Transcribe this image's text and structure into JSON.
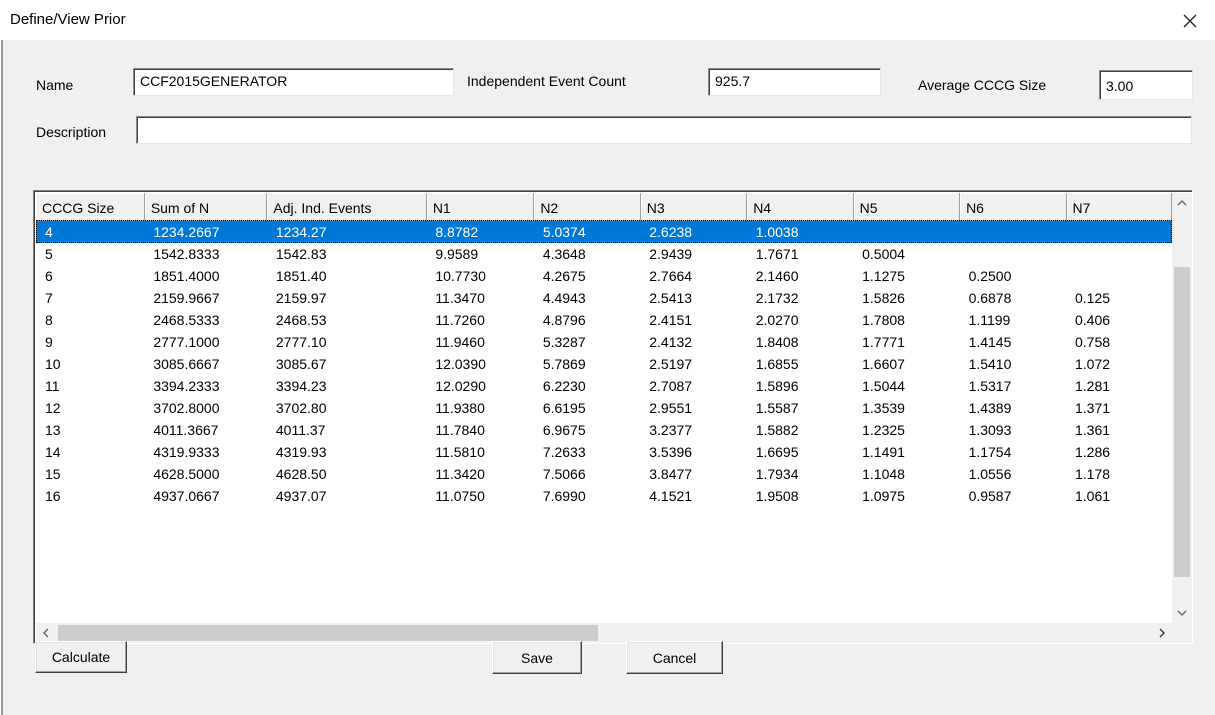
{
  "window": {
    "title": "Define/View Prior"
  },
  "form": {
    "name_label": "Name",
    "name_value": "CCF2015GENERATOR",
    "iec_label": "Independent Event Count",
    "iec_value": "925.7",
    "acs_label": "Average CCCG Size",
    "acs_value": "3.00",
    "desc_label": "Description",
    "desc_value": ""
  },
  "grid": {
    "columns": [
      "CCCG Size",
      "Sum of N",
      "Adj. Ind. Events",
      "N1",
      "N2",
      "N3",
      "N4",
      "N5",
      "N6",
      "N7"
    ],
    "selected_row": 0,
    "rows": [
      [
        "4",
        "1234.2667",
        "1234.27",
        "8.8782",
        "5.0374",
        "2.6238",
        "1.0038",
        "",
        "",
        ""
      ],
      [
        "5",
        "1542.8333",
        "1542.83",
        "9.9589",
        "4.3648",
        "2.9439",
        "1.7671",
        "0.5004",
        "",
        ""
      ],
      [
        "6",
        "1851.4000",
        "1851.40",
        "10.7730",
        "4.2675",
        "2.7664",
        "2.1460",
        "1.1275",
        "0.2500",
        ""
      ],
      [
        "7",
        "2159.9667",
        "2159.97",
        "11.3470",
        "4.4943",
        "2.5413",
        "2.1732",
        "1.5826",
        "0.6878",
        "0.125"
      ],
      [
        "8",
        "2468.5333",
        "2468.53",
        "11.7260",
        "4.8796",
        "2.4151",
        "2.0270",
        "1.7808",
        "1.1199",
        "0.406"
      ],
      [
        "9",
        "2777.1000",
        "2777.10",
        "11.9460",
        "5.3287",
        "2.4132",
        "1.8408",
        "1.7771",
        "1.4145",
        "0.758"
      ],
      [
        "10",
        "3085.6667",
        "3085.67",
        "12.0390",
        "5.7869",
        "2.5197",
        "1.6855",
        "1.6607",
        "1.5410",
        "1.072"
      ],
      [
        "11",
        "3394.2333",
        "3394.23",
        "12.0290",
        "6.2230",
        "2.7087",
        "1.5896",
        "1.5044",
        "1.5317",
        "1.281"
      ],
      [
        "12",
        "3702.8000",
        "3702.80",
        "11.9380",
        "6.6195",
        "2.9551",
        "1.5587",
        "1.3539",
        "1.4389",
        "1.371"
      ],
      [
        "13",
        "4011.3667",
        "4011.37",
        "11.7840",
        "6.9675",
        "3.2377",
        "1.5882",
        "1.2325",
        "1.3093",
        "1.361"
      ],
      [
        "14",
        "4319.9333",
        "4319.93",
        "11.5810",
        "7.2633",
        "3.5396",
        "1.6695",
        "1.1491",
        "1.1754",
        "1.286"
      ],
      [
        "15",
        "4628.5000",
        "4628.50",
        "11.3420",
        "7.5066",
        "3.8477",
        "1.7934",
        "1.1048",
        "1.0556",
        "1.178"
      ],
      [
        "16",
        "4937.0667",
        "4937.07",
        "11.0750",
        "7.6990",
        "4.1521",
        "1.9508",
        "1.0975",
        "0.9587",
        "1.061"
      ]
    ]
  },
  "buttons": {
    "calculate": "Calculate",
    "save": "Save",
    "cancel": "Cancel"
  },
  "colors": {
    "selection": "#0078d7",
    "dialog_bg": "#f0f0f0"
  }
}
